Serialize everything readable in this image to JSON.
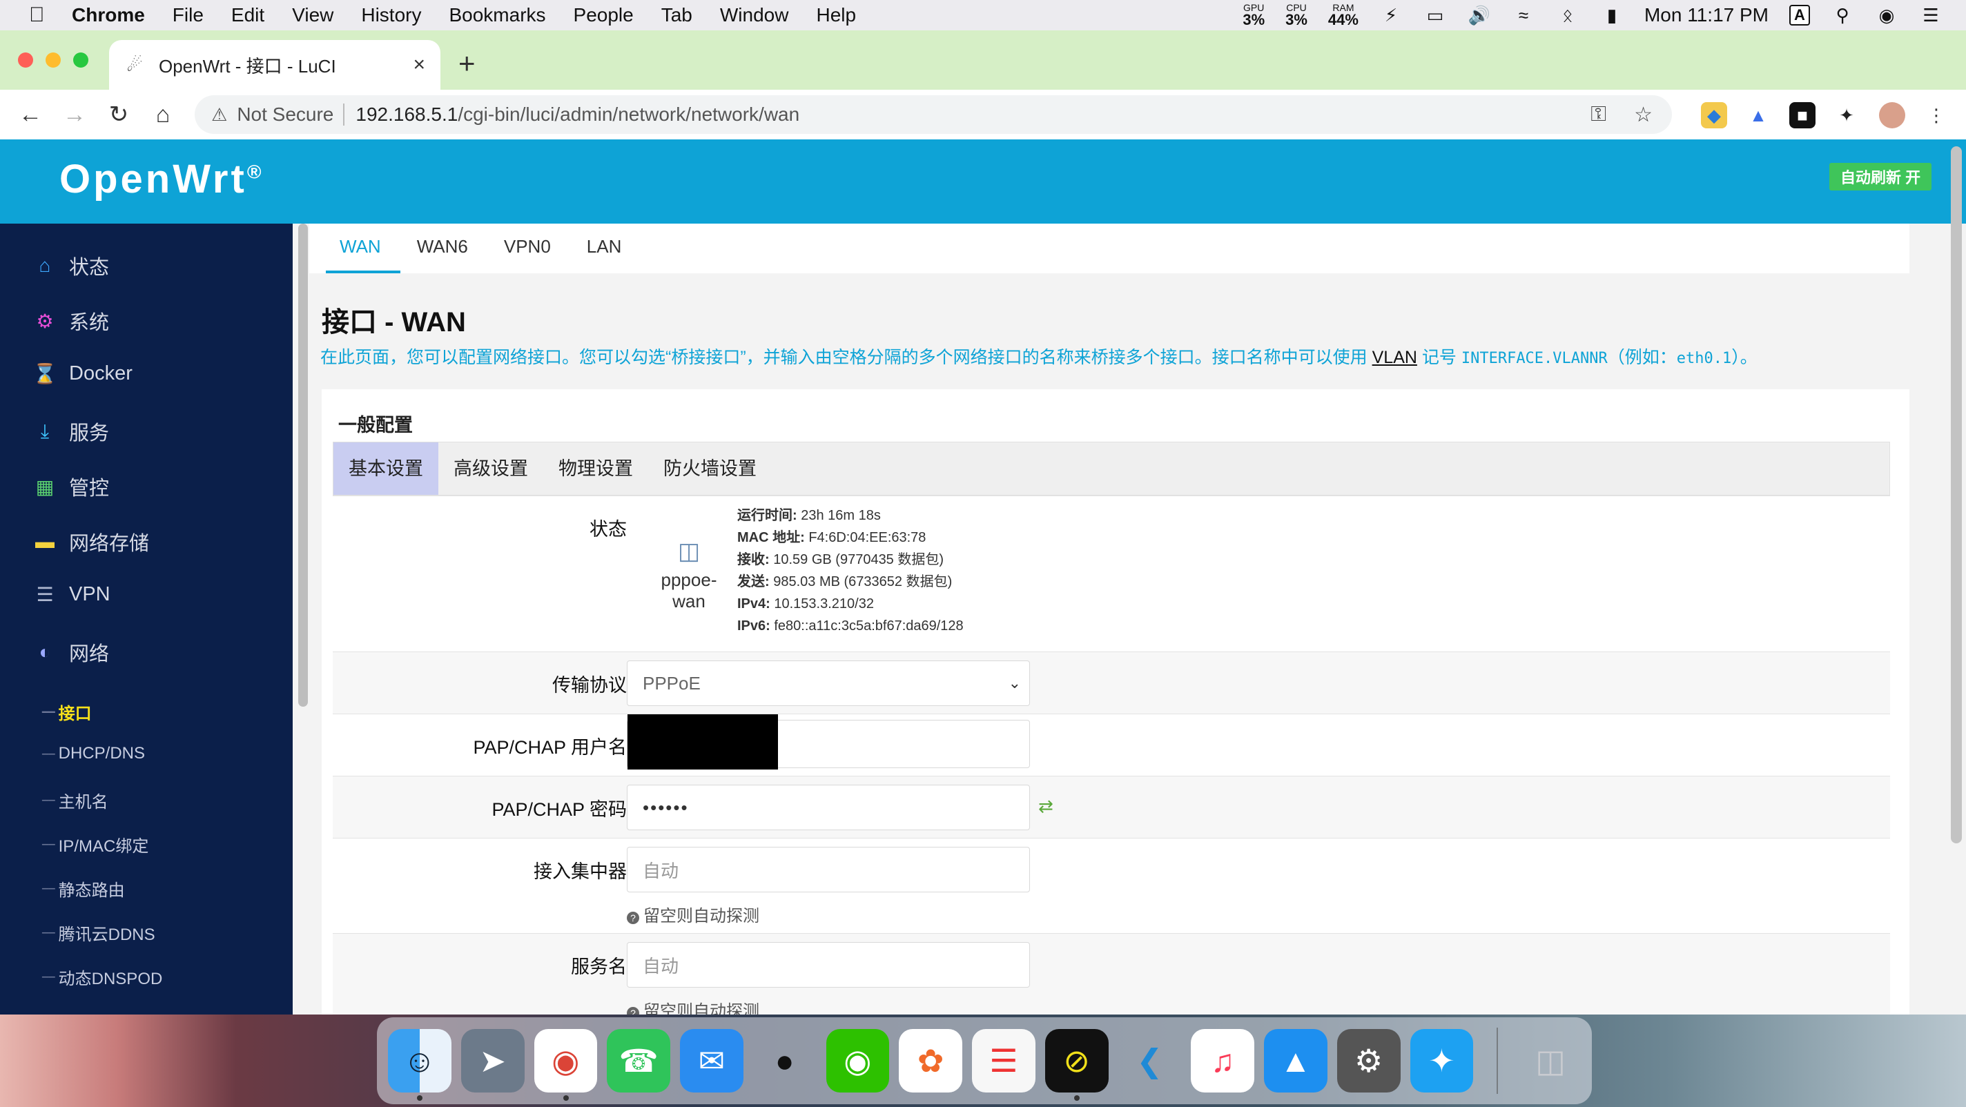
{
  "menubar": {
    "app_name": "Chrome",
    "items": [
      "File",
      "Edit",
      "View",
      "History",
      "Bookmarks",
      "People",
      "Tab",
      "Window",
      "Help"
    ],
    "gpu": {
      "label": "GPU",
      "value": "3%"
    },
    "cpu": {
      "label": "CPU",
      "value": "3%"
    },
    "ram": {
      "label": "RAM",
      "value": "44%"
    },
    "clock": "Mon 11:17 PM",
    "input_source": "A"
  },
  "browser": {
    "tab_title": "OpenWrt - 接口 - LuCI",
    "url_security": "Not Secure",
    "url_host": "192.168.5.1",
    "url_path": "/cgi-bin/luci/admin/network/network/wan"
  },
  "luci": {
    "logo": "OpenWrt",
    "logo_reg": "®",
    "auto_refresh": "自动刷新 开",
    "sidebar": {
      "items": [
        {
          "label": "状态",
          "icon": "home-icon"
        },
        {
          "label": "系统",
          "icon": "gear-icon"
        },
        {
          "label": "Docker",
          "icon": "hourglass-icon"
        },
        {
          "label": "服务",
          "icon": "download-icon"
        },
        {
          "label": "管控",
          "icon": "calendar-icon"
        },
        {
          "label": "网络存储",
          "icon": "drive-icon"
        },
        {
          "label": "VPN",
          "icon": "list-icon"
        },
        {
          "label": "网络",
          "icon": "globe-icon"
        }
      ],
      "subitems": [
        "接口",
        "DHCP/DNS",
        "主机名",
        "IP/MAC绑定",
        "静态路由",
        "腾讯云DDNS",
        "动态DNSPOD"
      ]
    },
    "iface_tabs": [
      "WAN",
      "WAN6",
      "VPN0",
      "LAN"
    ],
    "page_title": "接口 - WAN",
    "description_pre": "在此页面，您可以配置网络接口。您可以勾选“桥接接口”，并输入由空格分隔的多个网络接口的名称来桥接多个接口。接口名称中可以使用",
    "description_link": "VLAN",
    "description_mid": "记号",
    "description_code1": "INTERFACE.VLANNR",
    "description_mid2": "（例如：",
    "description_code2": "eth0.1",
    "description_post": "）。",
    "section_title": "一般配置",
    "subtabs": [
      "基本设置",
      "高级设置",
      "物理设置",
      "防火墙设置"
    ],
    "status": {
      "label": "状态",
      "iface_name": "pppoe-wan",
      "lines": [
        {
          "k": "运行时间:",
          "v": " 23h 16m 18s"
        },
        {
          "k": "MAC 地址:",
          "v": " F4:6D:04:EE:63:78"
        },
        {
          "k": "接收:",
          "v": " 10.59 GB (9770435 数据包)"
        },
        {
          "k": "发送:",
          "v": " 985.03 MB (6733652 数据包)"
        },
        {
          "k": "IPv4:",
          "v": " 10.153.3.210/32"
        },
        {
          "k": "IPv6:",
          "v": " fe80::a11c:3c5a:bf67:da69/128"
        }
      ]
    },
    "fields": {
      "protocol": {
        "label": "传输协议",
        "value": "PPPoE"
      },
      "username": {
        "label": "PAP/CHAP 用户名",
        "value": ""
      },
      "password": {
        "label": "PAP/CHAP 密码",
        "value": "••••••"
      },
      "ac": {
        "label": "接入集中器",
        "placeholder": "自动",
        "hint": "留空则自动探测"
      },
      "service": {
        "label": "服务名",
        "placeholder": "自动",
        "hint": "留空则自动探测"
      }
    }
  },
  "dock": {
    "apps": [
      "finder-icon",
      "launchpad-icon",
      "chrome-icon",
      "facetime-icon",
      "messages-icon",
      "qq-icon",
      "wechat-icon",
      "photos-icon",
      "reminders-icon",
      "instruments-icon",
      "vscode-icon",
      "music-icon",
      "appstore-icon",
      "preferences-icon",
      "twitter-icon"
    ],
    "trash": "trash-icon"
  },
  "colors": {
    "accent": "#0ea3d6",
    "sidebar_bg": "#0b1f4a",
    "active_sub": "#f7e01a",
    "tabbar_bg": "#d6efc6"
  }
}
